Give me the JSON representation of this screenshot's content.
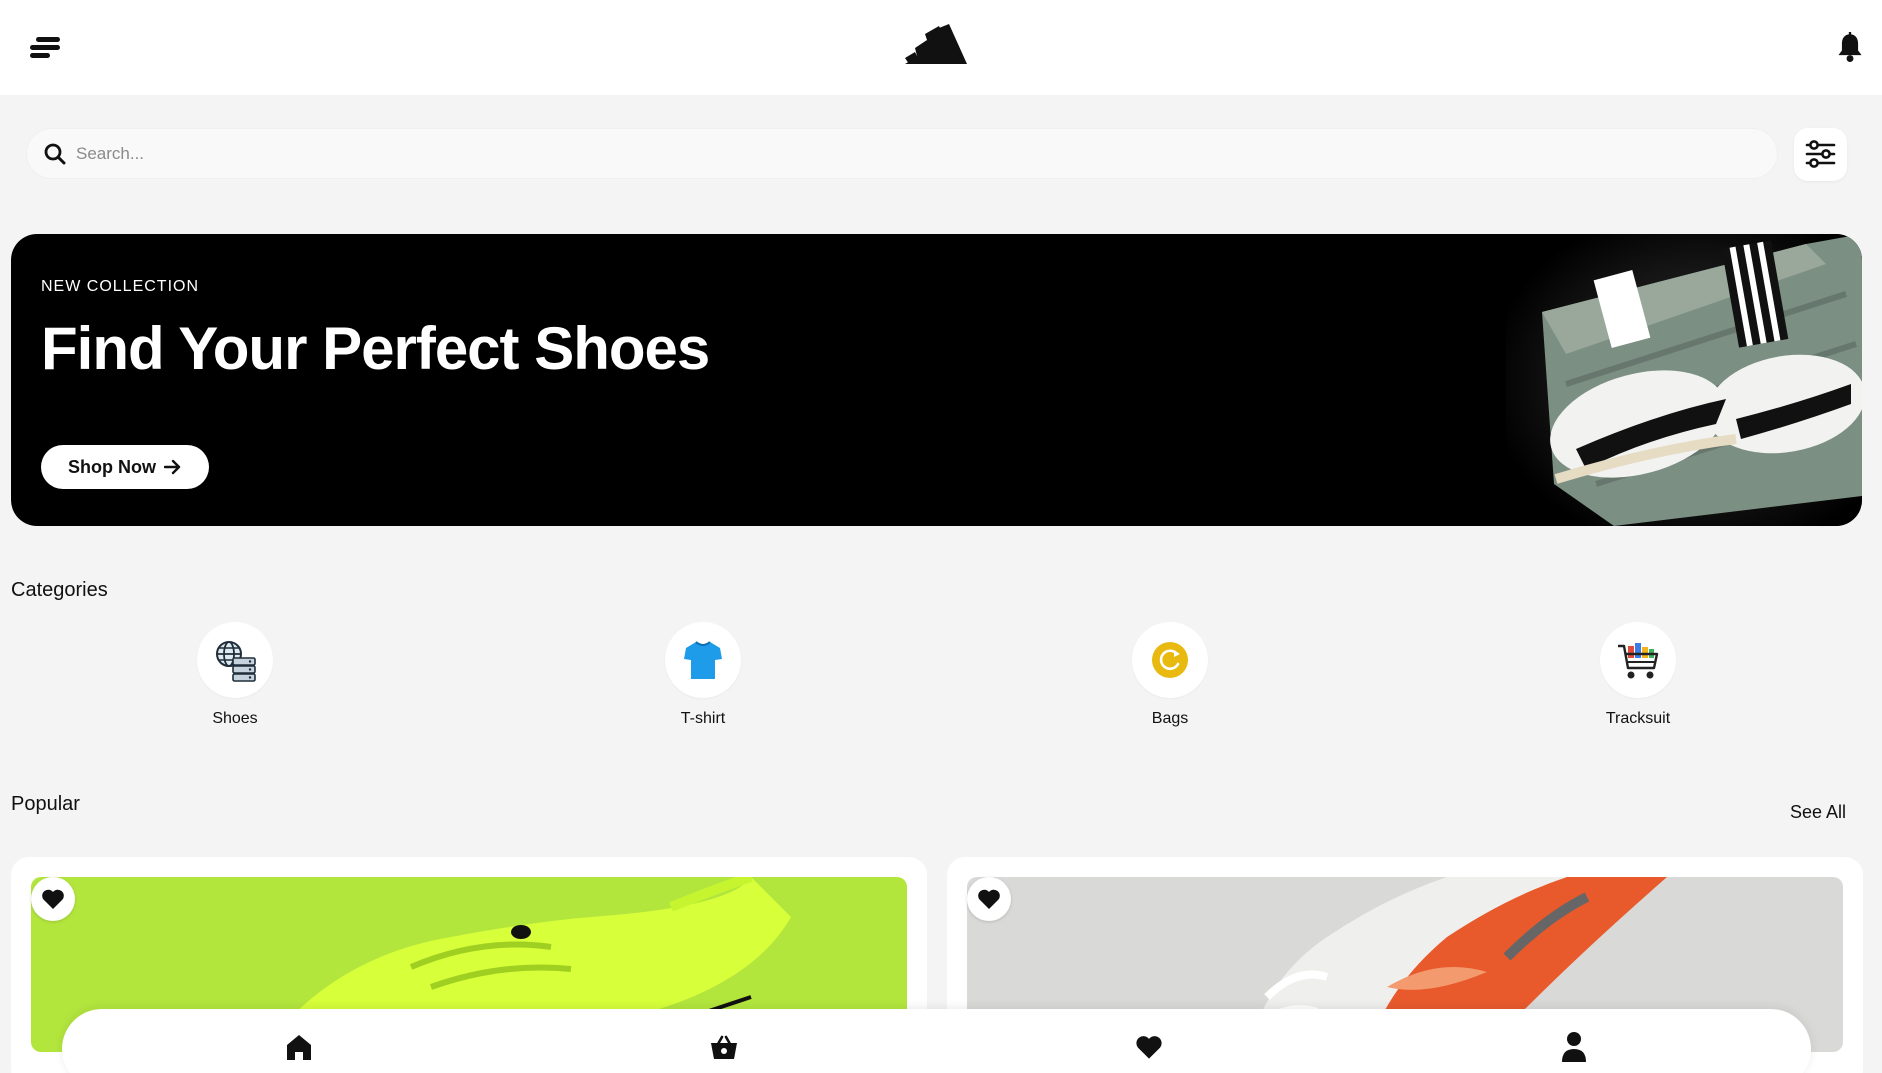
{
  "header": {
    "menu_icon": "menu-icon",
    "logo_icon": "adidas-logo-icon",
    "notification_icon": "bell-icon"
  },
  "search": {
    "placeholder": "Search...",
    "value": "",
    "filter_icon": "sliders-icon"
  },
  "banner": {
    "eyebrow": "NEW COLLECTION",
    "title": "Find Your Perfect Shoes",
    "button_label": "Shop Now",
    "button_icon": "arrow-right-icon",
    "background_color": "#000000"
  },
  "categories": {
    "title": "Categories",
    "items": [
      {
        "label": "Shoes",
        "icon": "globe-server-icon"
      },
      {
        "label": "T-shirt",
        "icon": "tshirt-icon"
      },
      {
        "label": "Bags",
        "icon": "refresh-coin-icon"
      },
      {
        "label": "Tracksuit",
        "icon": "shopping-cart-icon"
      }
    ]
  },
  "popular": {
    "title": "Popular",
    "see_all_label": "See All",
    "products": [
      {
        "image": "neon-green-sneaker",
        "favorite_icon": "heart-icon"
      },
      {
        "image": "white-orange-nike-sneaker",
        "favorite_icon": "heart-icon"
      }
    ]
  },
  "bottom_nav": {
    "items": [
      {
        "icon": "home-icon"
      },
      {
        "icon": "basket-icon"
      },
      {
        "icon": "heart-icon"
      },
      {
        "icon": "user-icon"
      }
    ]
  },
  "colors": {
    "page_background": "#f4f4f4",
    "accent_green": "#b3e63d",
    "tshirt_blue": "#1e9be9",
    "bags_yellow": "#e8b90f"
  }
}
